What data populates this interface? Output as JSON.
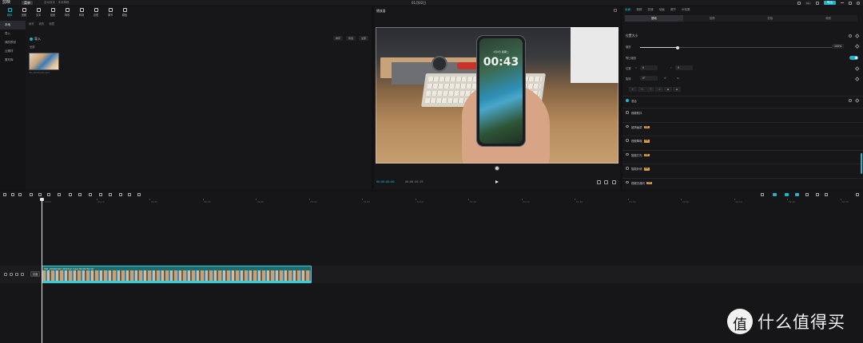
{
  "titlebar": {
    "app_name": "剪映",
    "menu_tag": "菜单",
    "autosave": "自动保存 · 本地草稿",
    "doc_title": "01月02日",
    "right_chip": "Lv",
    "export_label": "导出"
  },
  "toolbar": {
    "tools": [
      {
        "label": "媒体",
        "icon": "media-icon",
        "active": true
      },
      {
        "label": "音频",
        "icon": "audio-icon"
      },
      {
        "label": "文本",
        "icon": "text-icon"
      },
      {
        "label": "贴纸",
        "icon": "sticker-icon"
      },
      {
        "label": "特效",
        "icon": "effects-icon"
      },
      {
        "label": "转场",
        "icon": "transition-icon"
      },
      {
        "label": "滤镜",
        "icon": "filter-icon"
      },
      {
        "label": "调节",
        "icon": "adjust-icon"
      },
      {
        "label": "模板",
        "icon": "template-icon"
      }
    ]
  },
  "sidenav": {
    "items": [
      {
        "label": "本地",
        "active": true
      },
      {
        "label": "导入"
      },
      {
        "label": "我的预设"
      },
      {
        "label": "云素材"
      },
      {
        "label": "素材库"
      }
    ]
  },
  "media": {
    "subtabs": [
      "素材",
      "我的",
      "收藏"
    ],
    "import_label": "导入",
    "section_label": "全部",
    "controls": [
      "排序",
      "筛选",
      "全部"
    ],
    "thumb_caption": "VID_20240102.mp4"
  },
  "preview": {
    "header": "播放器",
    "phone_time": "00:43",
    "phone_date": "1月2日 星期二",
    "timecode_current": "00:00:00:00",
    "timecode_total": "00:00:56:19"
  },
  "inspector": {
    "tabs": [
      {
        "label": "画面",
        "active": true
      },
      {
        "label": "音频"
      },
      {
        "label": "变速"
      },
      {
        "label": "动画"
      },
      {
        "label": "调节"
      },
      {
        "label": "AI效果"
      }
    ],
    "segments": [
      {
        "label": "基础",
        "active": true
      },
      {
        "label": "抠像"
      },
      {
        "label": "蒙版"
      },
      {
        "label": "美颜"
      }
    ],
    "section_position": "位置大小",
    "scale_label": "缩放",
    "scale_value": "100%",
    "scale_fraction": 0.19,
    "uniform_label": "等比缩放",
    "position_label": "位置",
    "pos_x": "0",
    "pos_y": "0",
    "rotate_label": "旋转",
    "rotate_value": "0°",
    "align_buttons": [
      "⊢",
      "⊣",
      "⊤",
      "⊥",
      "⊞",
      "⊟"
    ],
    "blend_label": "混合",
    "options": [
      {
        "label": "视频防抖",
        "vip": false
      },
      {
        "label": "超清画质",
        "vip": true
      },
      {
        "label": "视频降噪",
        "vip": true
      },
      {
        "label": "智能打光",
        "vip": true
      },
      {
        "label": "智能补帧",
        "vip": true
      },
      {
        "label": "视频去频闪",
        "vip": true
      }
    ],
    "vip_badge": "VIP"
  },
  "timeline": {
    "ruler_ticks": [
      "00:00",
      "00:10",
      "00:20",
      "00:30",
      "00:40",
      "00:50",
      "01:00",
      "01:10",
      "01:20",
      "01:30",
      "01:40",
      "01:50",
      "02:00",
      "02:10",
      "02:20",
      "02:30"
    ],
    "cover_label": "封面",
    "clip_name": "VID_20240102_004312.mp4  00:00:56:19"
  },
  "watermark": {
    "text": "什么值得买"
  },
  "colors": {
    "accent": "#1fb4c9",
    "clip": "#1b6e70",
    "vip": "#d9a24a"
  }
}
